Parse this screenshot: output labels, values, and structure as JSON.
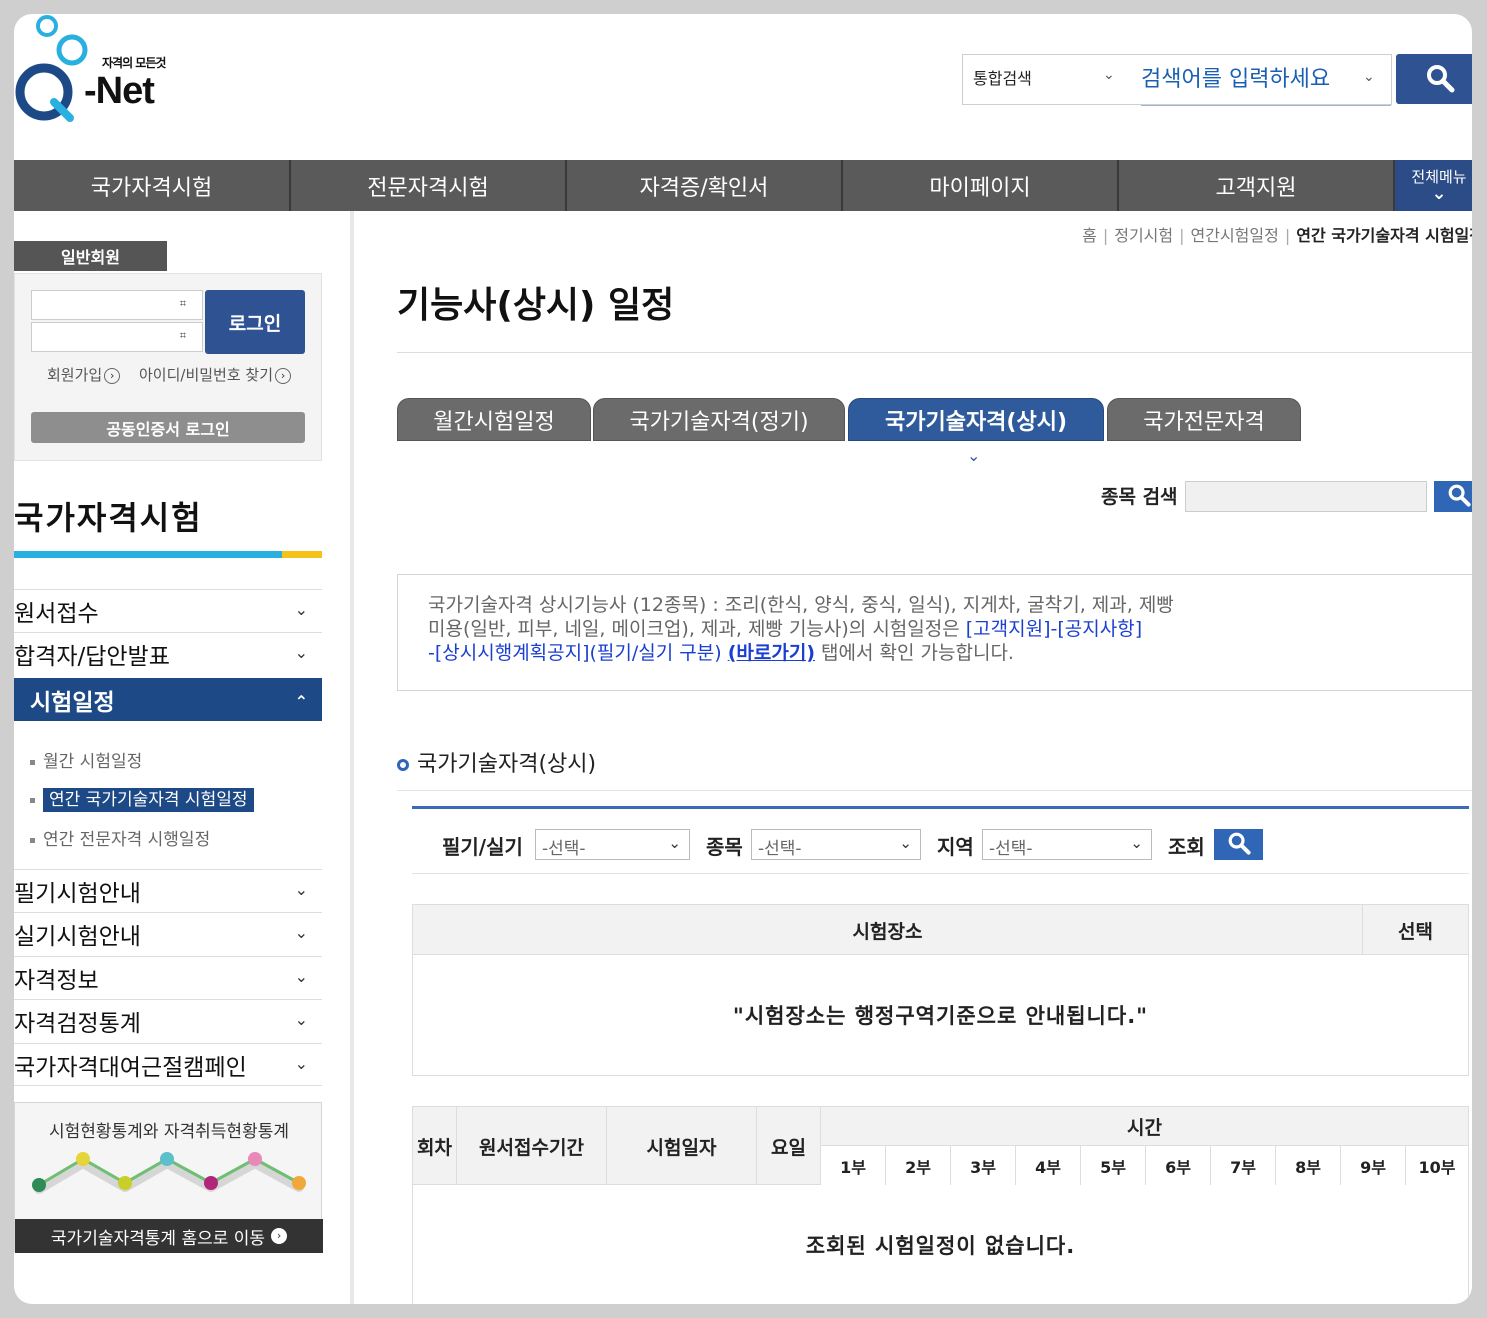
{
  "logo": {
    "tagline": "자격의 모든것",
    "name": "-Net"
  },
  "search": {
    "scope": "통합검색",
    "placeholder": "검색어를 입력하세요"
  },
  "topnav": {
    "items": [
      "국가자격시험",
      "전문자격시험",
      "자격증/확인서",
      "마이페이지",
      "고객지원"
    ],
    "all_menu": "전체메뉴"
  },
  "login": {
    "tab": "일반회원",
    "login_button": "로그인",
    "signup": "회원가입",
    "find_id_pw": "아이디/비밀번호 찾기",
    "cert_login": "공동인증서 로그인"
  },
  "sidebar": {
    "title": "국가자격시험",
    "items": [
      "원서접수",
      "합격자/답안발표",
      "시험일정",
      "필기시험안내",
      "실기시험안내",
      "자격정보",
      "자격검정통계",
      "국가자격대여근절캠페인"
    ],
    "subitems": [
      "월간 시험일정",
      "연간 국가기술자격 시험일정",
      "연간 전문자격 시행일정"
    ],
    "stat_banner_title": "시험현황통계와 자격취득현황통계",
    "stat_banner_link": "국가기술자격통계 홈으로 이동"
  },
  "breadcrumb": [
    "홈",
    "정기시험",
    "연간시험일정",
    "연간 국가기술자격 시험일정"
  ],
  "main": {
    "title": "기능사(상시) 일정",
    "tabs": [
      "월간시험일정",
      "국가기술자격(정기)",
      "국가기술자격(상시)",
      "국가전문자격"
    ],
    "item_search_label": "종목 검색",
    "notice": {
      "line1": "국가기술자격 상시기능사 (12종목) : 조리(한식, 양식, 중식, 일식), 지게차, 굴착기, 제과, 제빵",
      "line2a": "미용(일반, 피부, 네일, 메이크업), 제과, 제빵 기능사)의 시험일정은 ",
      "line2b": "[고객지원]-[공지사항]",
      "line3a": "-[상시시행계획공지](필기/실기 구분)",
      "line3b": "(바로가기)",
      "line3c": " 탭에서 확인 가능합니다."
    },
    "section_title": "국가기술자격(상시)",
    "filters": {
      "type_label": "필기/실기",
      "item_label": "종목",
      "region_label": "지역",
      "lookup_label": "조회",
      "placeholder": "-선택-"
    },
    "venue_table": {
      "headers": [
        "시험장소",
        "선택"
      ],
      "message": "\"시험장소는 행정구역기준으로 안내됩니다.\""
    },
    "schedule_table": {
      "headers": [
        "회차",
        "원서접수기간",
        "시험일자",
        "요일"
      ],
      "time_header": "시간",
      "parts": [
        "1부",
        "2부",
        "3부",
        "4부",
        "5부",
        "6부",
        "7부",
        "8부",
        "9부",
        "10부"
      ],
      "message": "조회된 시험일정이 없습니다."
    }
  },
  "colors": {
    "brand_blue": "#2f5392",
    "nav_gray": "#5a5a5a",
    "active_blue": "#1d4a86",
    "accent_cyan": "#2ab0e0",
    "accent_yellow": "#f5c21a"
  }
}
